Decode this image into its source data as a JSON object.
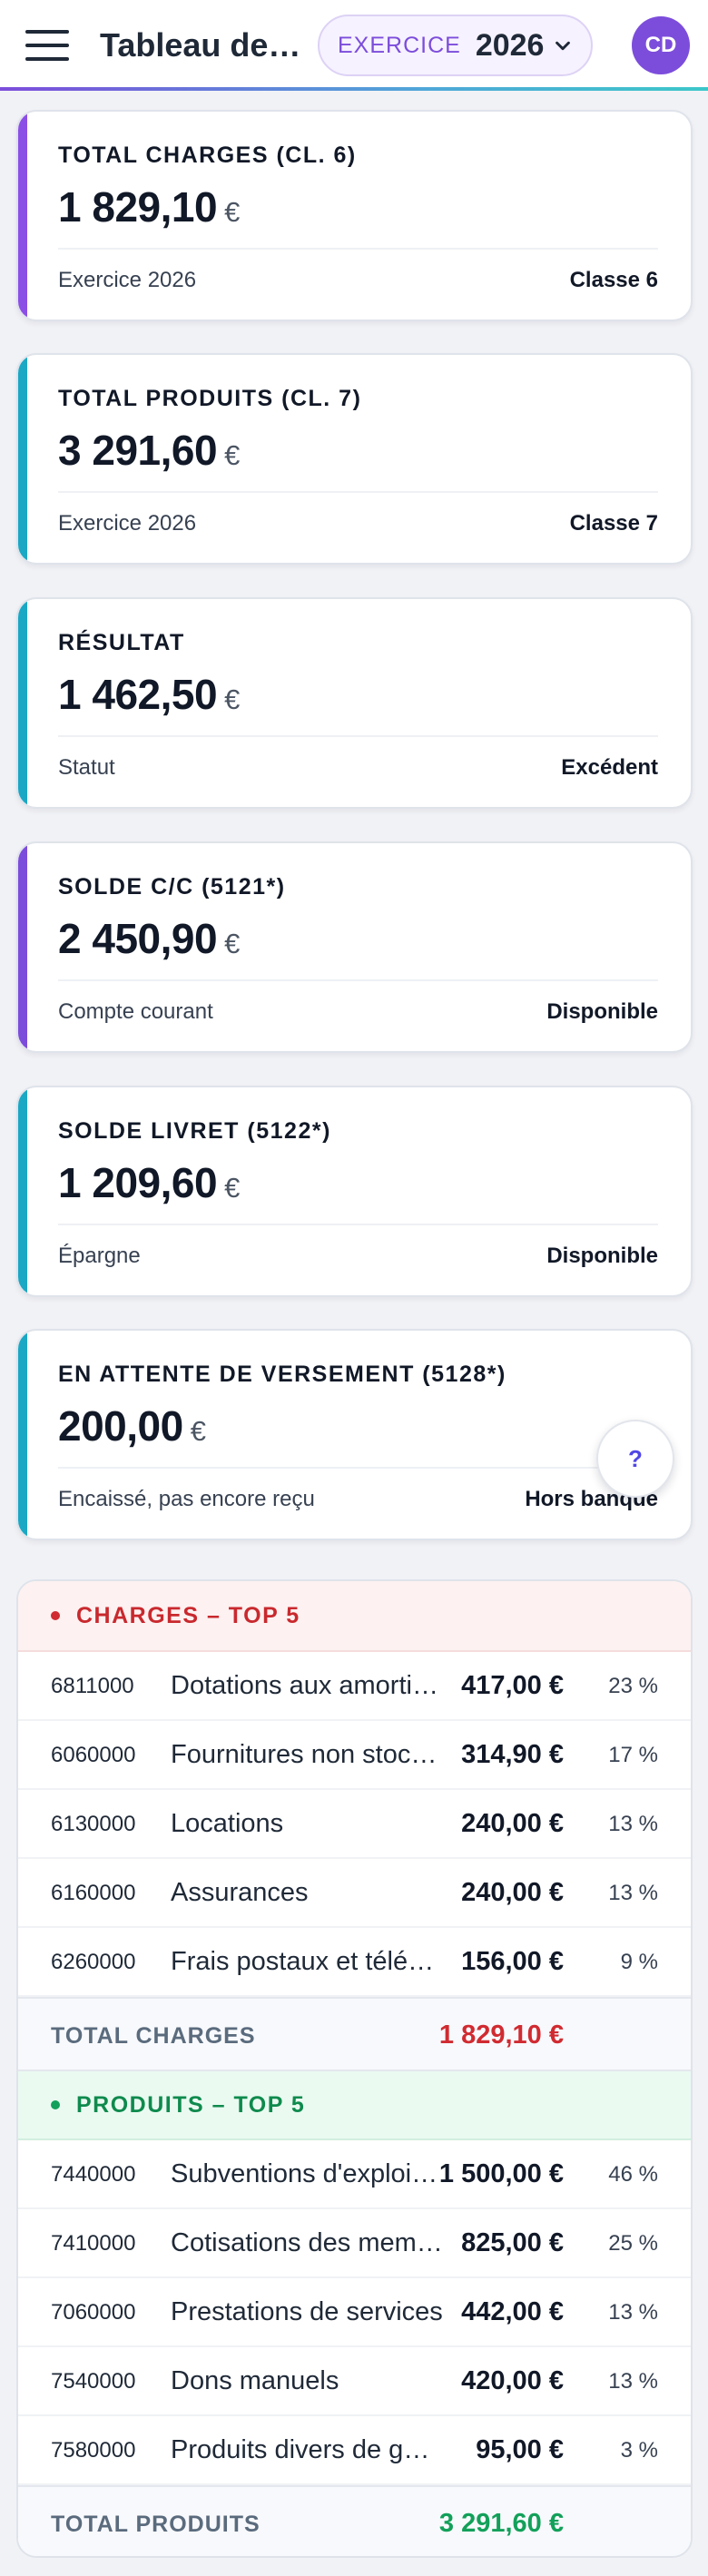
{
  "header": {
    "title": "Tableau de bord",
    "exercise_label": "EXERCICE",
    "exercise_year": "2026",
    "avatar_initials": "CD"
  },
  "colors": {
    "brand": "#7c4ddb",
    "accent_teal": "#1ba8c4",
    "charges_red": "#d02b31",
    "produits_green": "#13a05a"
  },
  "kpis": [
    {
      "label": "TOTAL CHARGES (CL. 6)",
      "value": "1 829,10",
      "currency": "€",
      "sub_left": "Exercice 2026",
      "sub_right": "Classe 6",
      "accent": "#8b4fe6"
    },
    {
      "label": "TOTAL PRODUITS (CL. 7)",
      "value": "3 291,60",
      "currency": "€",
      "sub_left": "Exercice 2026",
      "sub_right": "Classe 7",
      "accent": "#1ba8c4"
    },
    {
      "label": "RÉSULTAT",
      "value": "1 462,50",
      "currency": "€",
      "sub_left": "Statut",
      "sub_right": "Excédent",
      "accent": "#1ba8c4"
    },
    {
      "label": "SOLDE C/C (5121*)",
      "value": "2 450,90",
      "currency": "€",
      "sub_left": "Compte courant",
      "sub_right": "Disponible",
      "accent": "#7c4ddb"
    },
    {
      "label": "SOLDE LIVRET (5122*)",
      "value": "1 209,60",
      "currency": "€",
      "sub_left": "Épargne",
      "sub_right": "Disponible",
      "accent": "#1ba8c4"
    },
    {
      "label": "EN ATTENTE DE VERSEMENT (5128*)",
      "value": "200,00",
      "currency": "€",
      "sub_left": "Encaissé, pas encore reçu",
      "sub_right": "Hors banque",
      "accent": "#1ba8c4"
    }
  ],
  "help": {
    "label": "?"
  },
  "charges": {
    "title": "CHARGES – TOP 5",
    "rows": [
      {
        "code": "6811000",
        "label": "Dotations aux amortissements",
        "amount": "417,00 €",
        "pct": "23 %"
      },
      {
        "code": "6060000",
        "label": "Fournitures non stockées",
        "amount": "314,90 €",
        "pct": "17 %"
      },
      {
        "code": "6130000",
        "label": "Locations",
        "amount": "240,00 €",
        "pct": "13 %"
      },
      {
        "code": "6160000",
        "label": "Assurances",
        "amount": "240,00 €",
        "pct": "13 %"
      },
      {
        "code": "6260000",
        "label": "Frais postaux et télécommunications",
        "amount": "156,00 €",
        "pct": "9 %"
      }
    ],
    "total_label": "TOTAL CHARGES",
    "total_amount": "1 829,10 €"
  },
  "produits": {
    "title": "PRODUITS – TOP 5",
    "rows": [
      {
        "code": "7440000",
        "label": "Subventions d'exploitation",
        "amount": "1 500,00 €",
        "pct": "46 %"
      },
      {
        "code": "7410000",
        "label": "Cotisations des membres",
        "amount": "825,00 €",
        "pct": "25 %"
      },
      {
        "code": "7060000",
        "label": "Prestations de services",
        "amount": "442,00 €",
        "pct": "13 %"
      },
      {
        "code": "7540000",
        "label": "Dons manuels",
        "amount": "420,00 €",
        "pct": "13 %"
      },
      {
        "code": "7580000",
        "label": "Produits divers de gestion",
        "amount": "95,00 €",
        "pct": "3 %"
      }
    ],
    "total_label": "TOTAL PRODUITS",
    "total_amount": "3 291,60 €"
  }
}
